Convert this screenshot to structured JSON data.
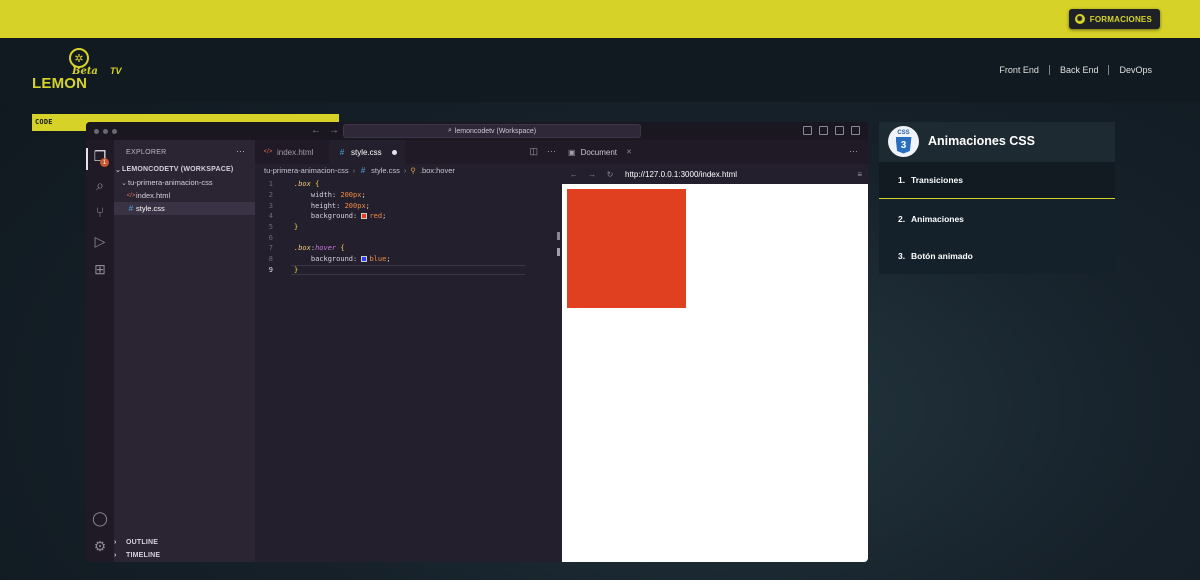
{
  "topbar": {
    "formaciones_label": "FORMACIONES",
    "formaciones_icon": "gear-icon",
    "accent_color": "#d6d228"
  },
  "logo": {
    "beta": "Beta",
    "tv": "TV",
    "lemon": "LEMON",
    "code": "CODE"
  },
  "nav": {
    "items": [
      "Front End",
      "Back End",
      "DevOps"
    ]
  },
  "vscode": {
    "command_center": "lemoncodetv (Workspace)",
    "activity_badge": "1",
    "explorer": {
      "title": "EXPLORER",
      "more": "···",
      "workspace": "LEMONCODETV (WORKSPACE)",
      "folder": "tu-primera-animacion-css",
      "files": [
        "index.html",
        "style.css"
      ],
      "selected_file": "style.css",
      "outline": "OUTLINE",
      "timeline": "TIMELINE"
    },
    "tabs": [
      "index.html",
      "style.css"
    ],
    "active_tab": "style.css",
    "breadcrumb": [
      "tu-primera-animacion-css",
      "style.css",
      ".box:hover"
    ],
    "code_lines": [
      ".box {",
      "    width: 200px;",
      "    height: 200px;",
      "    background: red;",
      "}",
      "",
      ".box:hover {",
      "    background: blue;",
      "}"
    ],
    "current_line": 9,
    "browser": {
      "tab_label": "Document",
      "close": "✕",
      "url": "http://127.0.0.1:3000/index.html",
      "box_color": "#e0401f"
    }
  },
  "course": {
    "title": "Animaciones CSS",
    "logo_text": "CSS",
    "lessons": [
      {
        "num": "1.",
        "label": "Transiciones",
        "active": true
      },
      {
        "num": "2.",
        "label": "Animaciones",
        "active": false
      },
      {
        "num": "3.",
        "label": "Botón animado",
        "active": false
      }
    ]
  }
}
